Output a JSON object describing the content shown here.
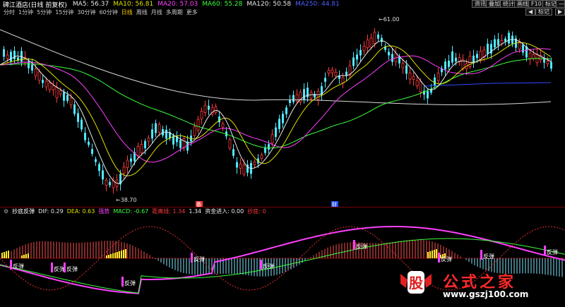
{
  "header": {
    "stock_title": "碑江酒店(日线 前复权)",
    "ma5": "MA5: 56.37",
    "ma10": "MA10: 56.81",
    "ma20": "MA20: 57.03",
    "ma60": "MA60: 55.28",
    "ma120": "MA120: 50.58",
    "ma250": "MA250: 44.81",
    "right_buttons": [
      "资讯",
      "叠加",
      "统计",
      "画线",
      "F10",
      "标记",
      "—",
      "◇",
      "✕"
    ]
  },
  "period_tabs": [
    "分时",
    "1分钟",
    "5分钟",
    "15分钟",
    "30分钟",
    "60分钟",
    "日线",
    "周线",
    "月线",
    "多周期",
    "更多"
  ],
  "active_period": "日线",
  "side_buttons": [
    "◀",
    "标记",
    "▶"
  ],
  "price_chart": {
    "high_label": "61.00",
    "low_label": "38.70",
    "event_markers": [
      "备",
      "财"
    ]
  },
  "indicator": {
    "name": "抄底反弹",
    "dif": "DIF: 0.29",
    "dea": "DEA: 0.63",
    "accel": "强势",
    "macd": "MACD: -0.67",
    "dist": "距离线: 1.34",
    "dist2": "1.34",
    "capital": "资金进入: 0.00",
    "signal": "抄底: 0",
    "signal_label": "反弹"
  },
  "watermark": {
    "logo_char": "股",
    "site_name": "公式之家",
    "url": "www.gszj100.com"
  },
  "colors": {
    "up": "#ff3b3b",
    "down": "#4fe8ff",
    "ma5": "#e8e8e8",
    "ma10": "#e0e000",
    "ma20": "#ff40ff",
    "ma60": "#3cff3c",
    "ma250": "#4a60ff"
  }
}
